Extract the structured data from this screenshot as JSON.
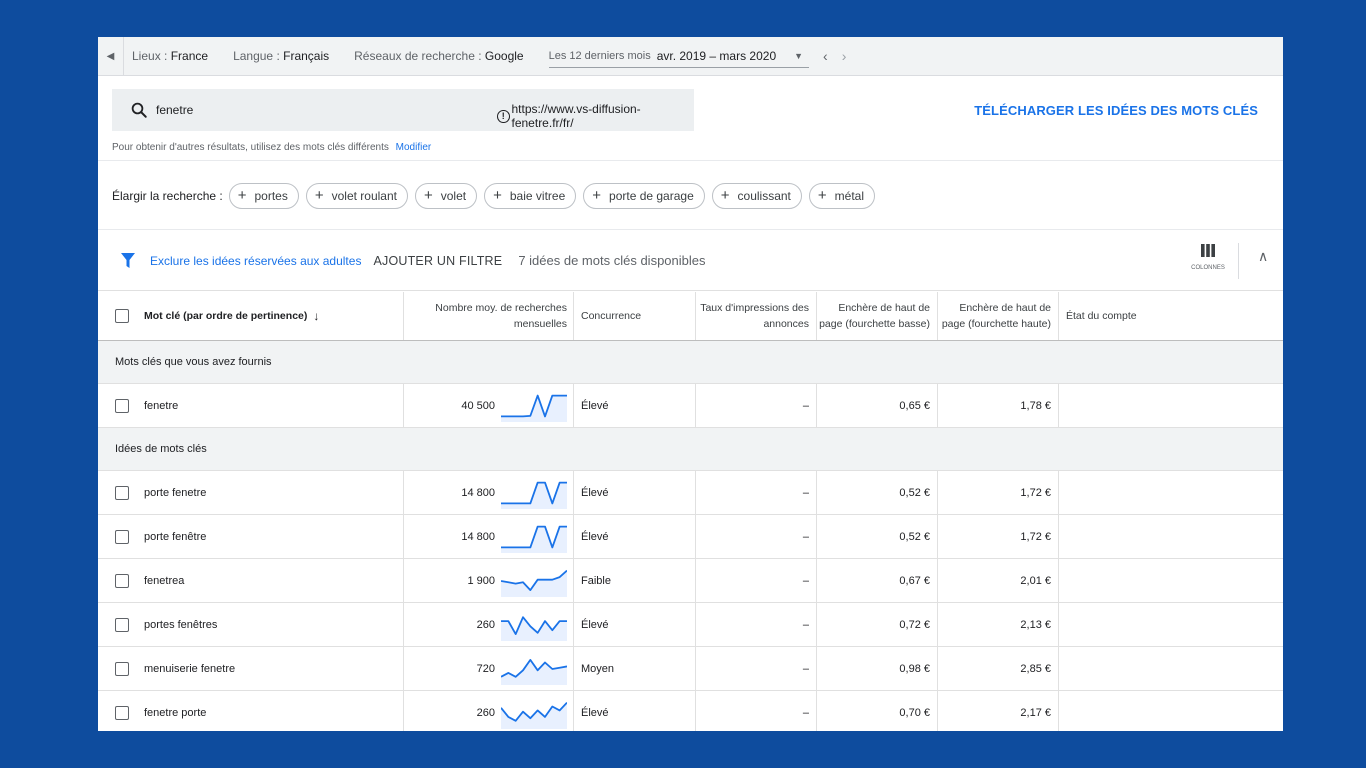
{
  "topbar": {
    "locations_label": "Lieux :",
    "locations_value": "France",
    "language_label": "Langue :",
    "language_value": "Français",
    "network_label": "Réseaux de recherche :",
    "network_value": "Google",
    "period_label": "Les 12 derniers mois",
    "period_value": "avr. 2019 – mars 2020"
  },
  "search": {
    "query": "fenetre",
    "url": "https://www.vs-diffusion-fenetre.fr/fr/",
    "download_label": "TÉLÉCHARGER LES IDÉES DES MOTS CLÉS",
    "hint": "Pour obtenir d'autres résultats, utilisez des mots clés différents",
    "modify_label": "Modifier"
  },
  "broaden": {
    "label": "Élargir la recherche :",
    "chips": [
      "portes",
      "volet roulant",
      "volet",
      "baie vitree",
      "porte de garage",
      "coulissant",
      "métal"
    ]
  },
  "filters": {
    "exclude_adult": "Exclure les idées réservées aux adultes",
    "add_filter": "AJOUTER UN FILTRE",
    "count_text": "7 idées de mots clés disponibles",
    "columns_label": "COLONNES"
  },
  "table": {
    "headers": {
      "keyword": "Mot clé (par ordre de pertinence)",
      "volume": "Nombre moy. de recherches mensuelles",
      "competition": "Concurrence",
      "impression_share": "Taux d'impressions des annonces",
      "bid_low": "Enchère de haut de page (fourchette basse)",
      "bid_high": "Enchère de haut de page (fourchette haute)",
      "account_status": "État du compte"
    },
    "group_provided": "Mots clés que vous avez fournis",
    "group_ideas": "Idées de mots clés",
    "provided_rows": [
      {
        "keyword": "fenetre",
        "volume": "40 500",
        "competition": "Élevé",
        "impressions": "–",
        "bid_low": "0,65 €",
        "bid_high": "1,78 €",
        "trend": [
          0.1,
          0.1,
          0.1,
          0.1,
          0.12,
          0.9,
          0.1,
          0.9,
          0.9,
          0.9
        ]
      }
    ],
    "idea_rows": [
      {
        "keyword": "porte fenetre",
        "volume": "14 800",
        "competition": "Élevé",
        "impressions": "–",
        "bid_low": "0,52 €",
        "bid_high": "1,72 €",
        "trend": [
          0.1,
          0.1,
          0.1,
          0.1,
          0.1,
          0.9,
          0.9,
          0.1,
          0.9,
          0.9
        ]
      },
      {
        "keyword": "porte fenêtre",
        "volume": "14 800",
        "competition": "Élevé",
        "impressions": "–",
        "bid_low": "0,52 €",
        "bid_high": "1,72 €",
        "trend": [
          0.1,
          0.1,
          0.1,
          0.1,
          0.1,
          0.9,
          0.9,
          0.1,
          0.9,
          0.9
        ]
      },
      {
        "keyword": "fenetrea",
        "volume": "1 900",
        "competition": "Faible",
        "impressions": "–",
        "bid_low": "0,67 €",
        "bid_high": "2,01 €",
        "trend": [
          0.5,
          0.45,
          0.4,
          0.45,
          0.15,
          0.55,
          0.55,
          0.55,
          0.65,
          0.9
        ]
      },
      {
        "keyword": "portes fenêtres",
        "volume": "260",
        "competition": "Élevé",
        "impressions": "–",
        "bid_low": "0,72 €",
        "bid_high": "2,13 €",
        "trend": [
          0.65,
          0.65,
          0.15,
          0.8,
          0.45,
          0.2,
          0.65,
          0.3,
          0.65,
          0.65
        ]
      },
      {
        "keyword": "menuiserie fenetre",
        "volume": "720",
        "competition": "Moyen",
        "impressions": "–",
        "bid_low": "0,98 €",
        "bid_high": "2,85 €",
        "trend": [
          0.2,
          0.35,
          0.2,
          0.45,
          0.85,
          0.45,
          0.75,
          0.5,
          0.55,
          0.6
        ]
      },
      {
        "keyword": "fenetre porte",
        "volume": "260",
        "competition": "Élevé",
        "impressions": "–",
        "bid_low": "0,70 €",
        "bid_high": "2,17 €",
        "trend": [
          0.7,
          0.35,
          0.2,
          0.55,
          0.3,
          0.6,
          0.35,
          0.75,
          0.6,
          0.9
        ]
      }
    ]
  },
  "colors": {
    "background": "#0e4c9e",
    "accent": "#1a73e8",
    "sparkline_fill": "#e8f0fe"
  },
  "icons": [
    "back-arrow-icon",
    "dropdown-icon",
    "chevron-left-icon",
    "chevron-right-icon",
    "search-icon",
    "info-icon",
    "plus-icon",
    "filter-icon",
    "columns-icon",
    "collapse-icon",
    "sort-arrow-icon",
    "checkbox-icon"
  ]
}
